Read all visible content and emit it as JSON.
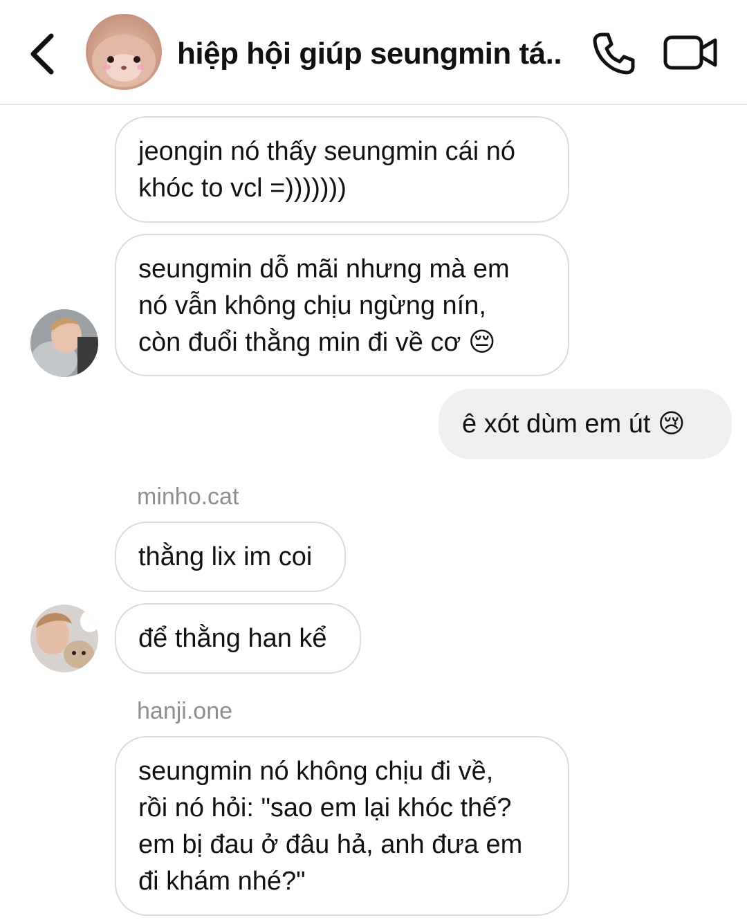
{
  "header": {
    "title": "hiệp hội giúp seungmin tá..",
    "back_icon": "chevron-left-icon",
    "call_icon": "phone-icon",
    "video_icon": "video-camera-icon"
  },
  "messages": [
    {
      "id": "m1",
      "direction": "received",
      "lines": [
        "jeongin nó thấy seungmin cái nó",
        "khóc to vcl =)))))))"
      ]
    },
    {
      "id": "m2",
      "direction": "received",
      "lines": [
        "seungmin dỗ mãi nhưng mà em",
        "nó vẫn không chịu ngừng nín,",
        "còn đuổi thằng min đi về cơ 😔"
      ]
    },
    {
      "id": "m3",
      "direction": "sent",
      "lines": [
        "ê xót dùm em út 😢"
      ]
    },
    {
      "id": "m4",
      "direction": "received",
      "sender": "minho.cat",
      "lines": [
        "thằng lix im coi"
      ]
    },
    {
      "id": "m5",
      "direction": "received",
      "lines": [
        "để thằng han kể"
      ]
    },
    {
      "id": "m6",
      "direction": "received",
      "sender": "hanji.one",
      "lines": [
        "seungmin nó không chịu đi về,",
        "rồi nó hỏi: \"sao em lại khóc thế?",
        "em bị đau ở đâu hả, anh đưa em",
        "đi khám nhé?\""
      ]
    }
  ],
  "colors": {
    "received_bubble_border": "#dbdbdb",
    "sent_bubble_bg": "#efefef",
    "sender_name": "#8e8e8e",
    "text": "#111111"
  }
}
